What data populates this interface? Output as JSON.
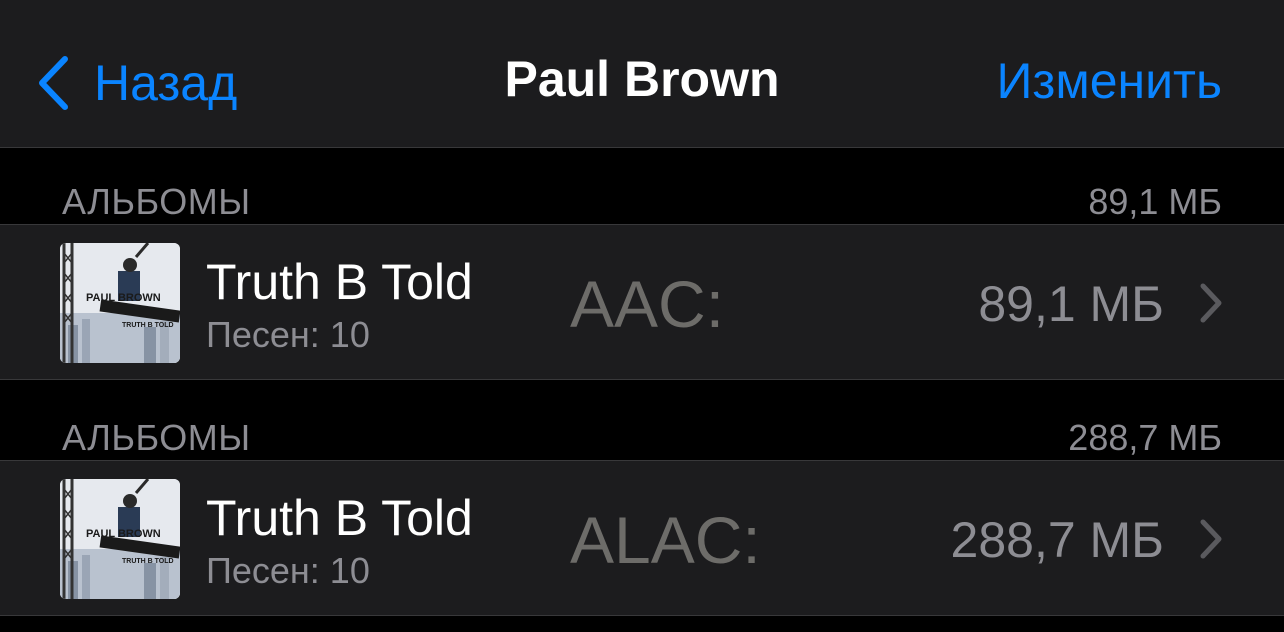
{
  "navbar": {
    "back_label": "Назад",
    "title": "Paul Brown",
    "edit_label": "Изменить"
  },
  "sections": [
    {
      "header_label": "АЛЬБОМЫ",
      "header_size": "89,1 МБ",
      "album": {
        "title": "Truth B Told",
        "songs": "Песен: 10",
        "format": "AAC:",
        "size": "89,1 МБ",
        "artwork_artist": "PAUL BROWN",
        "artwork_title": "TRUTH B TOLD"
      }
    },
    {
      "header_label": "АЛЬБОМЫ",
      "header_size": "288,7 МБ",
      "album": {
        "title": "Truth B Told",
        "songs": "Песен: 10",
        "format": "ALAC:",
        "size": "288,7 МБ",
        "artwork_artist": "PAUL BROWN",
        "artwork_title": "TRUTH B TOLD"
      }
    }
  ],
  "colors": {
    "accent": "#0a84ff",
    "background": "#000000",
    "cell": "#1c1c1e",
    "secondary_text": "#8d8d93"
  }
}
